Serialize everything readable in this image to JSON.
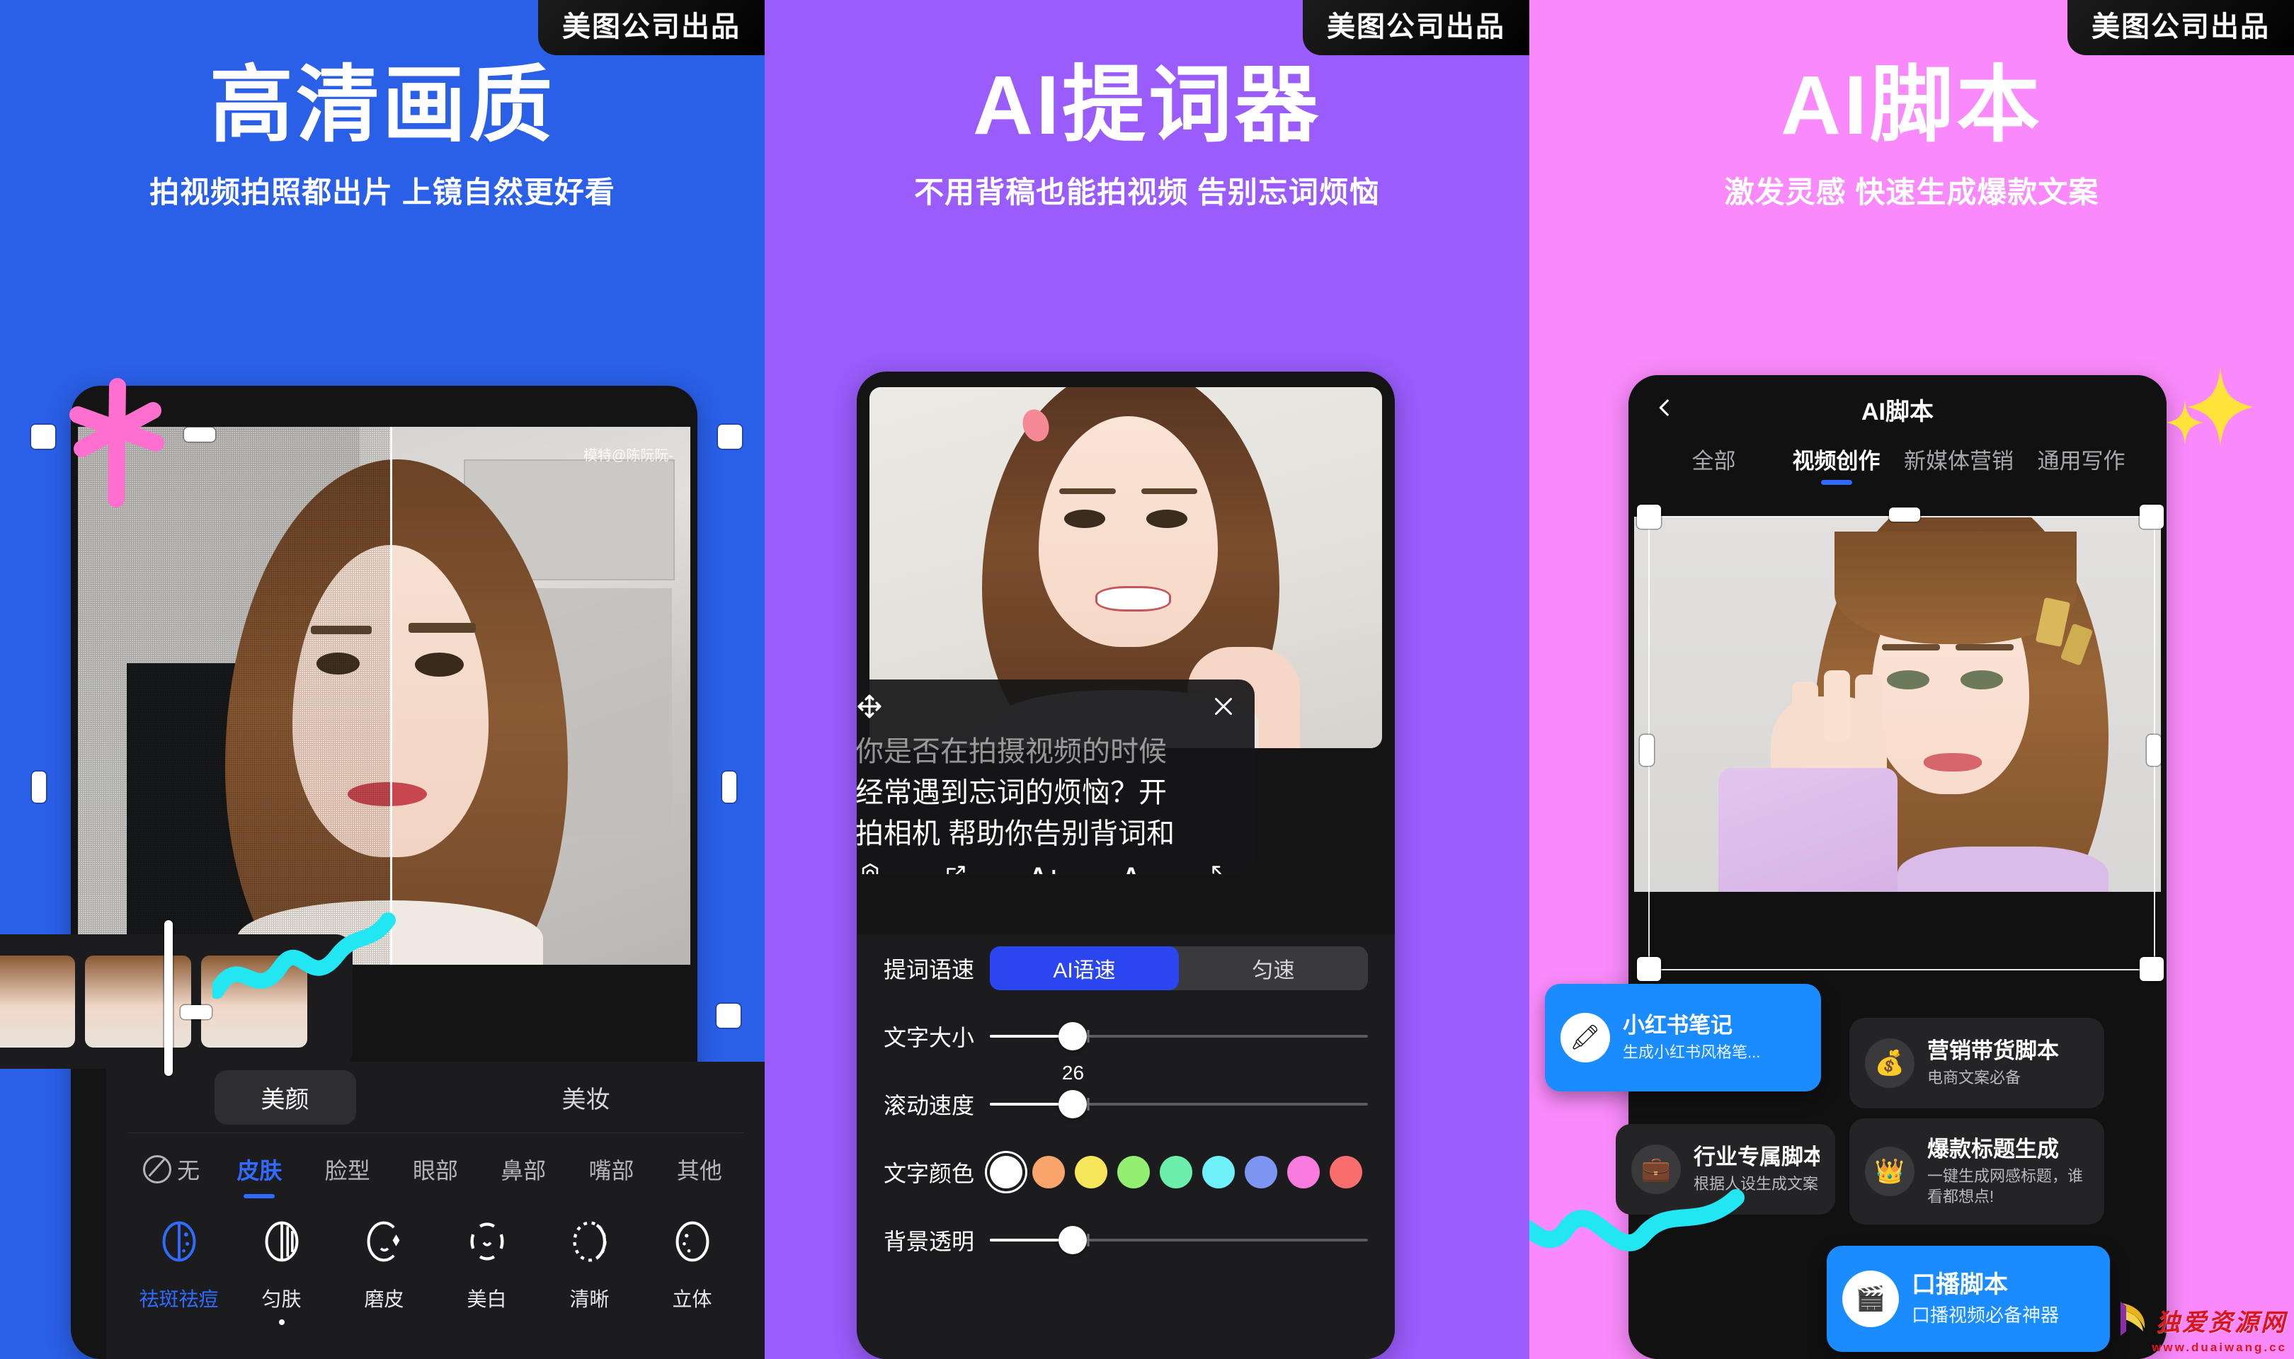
{
  "badge_label": "美图公司出品",
  "panels": [
    {
      "key": "hd",
      "bg": "#2A5FE8",
      "headline": "高清画质",
      "subhead": "拍视频拍照都出片 上镜自然更好看",
      "photo_credit": "模特@陈阮阮-",
      "bottom": {
        "tabs": [
          {
            "label": "美颜",
            "selected": true
          },
          {
            "label": "美妆",
            "selected": false
          }
        ],
        "categories": [
          {
            "label": "无",
            "icon": "none-circle-icon",
            "active": false
          },
          {
            "label": "皮肤",
            "active": true
          },
          {
            "label": "脸型",
            "active": false
          },
          {
            "label": "眼部",
            "active": false
          },
          {
            "label": "鼻部",
            "active": false
          },
          {
            "label": "嘴部",
            "active": false
          },
          {
            "label": "其他",
            "active": false
          }
        ],
        "tools": [
          {
            "label": "祛斑祛痘",
            "icon": "blemish-remove-icon",
            "active": true,
            "dot": false
          },
          {
            "label": "匀肤",
            "icon": "even-skin-icon",
            "active": false,
            "dot": true
          },
          {
            "label": "磨皮",
            "icon": "smooth-skin-icon",
            "active": false,
            "dot": false
          },
          {
            "label": "美白",
            "icon": "whiten-icon",
            "active": false,
            "dot": false
          },
          {
            "label": "清晰",
            "icon": "sharpen-icon",
            "active": false,
            "dot": false
          },
          {
            "label": "立体",
            "icon": "contour-icon",
            "active": false,
            "dot": false
          }
        ]
      }
    },
    {
      "key": "teleprompter",
      "bg": "#9A5CFC",
      "headline": "AI提词器",
      "subhead": "不用背稿也能拍视频 告别忘词烦恼",
      "teleprompter": {
        "move_icon": "move-arrows-icon",
        "close_icon": "close-icon",
        "lines": [
          {
            "text": "你是否在拍摄视频的时候",
            "dim": true
          },
          {
            "text": "经常遇到忘词的烦恼？开",
            "dim": false
          },
          {
            "text": "拍相机 帮助你告别背词和",
            "dim": false
          }
        ],
        "footer_icons": [
          {
            "name": "camera-icon",
            "glyph": "◎"
          },
          {
            "name": "edit-icon",
            "glyph": "✎"
          },
          {
            "name": "font-increase-icon",
            "glyph": "A+"
          },
          {
            "name": "font-decrease-icon",
            "glyph": "A-"
          },
          {
            "name": "resize-icon",
            "glyph": "⤢"
          }
        ]
      },
      "settings": {
        "speed_label": "提词语速",
        "speed_options": [
          {
            "label": "AI语速",
            "selected": true
          },
          {
            "label": "匀速",
            "selected": false
          }
        ],
        "text_size_label": "文字大小",
        "text_size_value": 22,
        "scroll_speed_label": "滚动速度",
        "scroll_speed_value": 26,
        "text_color_label": "文字颜色",
        "colors": [
          {
            "hex": "#FFFFFF",
            "selected": true
          },
          {
            "hex": "#F9A46A",
            "selected": false
          },
          {
            "hex": "#F7E55A",
            "selected": false
          },
          {
            "hex": "#93EE72",
            "selected": false
          },
          {
            "hex": "#6BEFAA",
            "selected": false
          },
          {
            "hex": "#6DF0F7",
            "selected": false
          },
          {
            "hex": "#7D96F2",
            "selected": false
          },
          {
            "hex": "#F97BE0",
            "selected": false
          },
          {
            "hex": "#F96D6D",
            "selected": false
          }
        ],
        "bg_opacity_label": "背景透明",
        "bg_opacity_value": 22
      }
    },
    {
      "key": "ai-script",
      "bg": "#FA8AFC",
      "headline": "AI脚本",
      "subhead": "激发灵感 快速生成爆款文案",
      "header": {
        "back_icon": "back-chevron-icon",
        "title": "AI脚本",
        "tabs": [
          {
            "label": "全部",
            "active": false
          },
          {
            "label": "视频创作",
            "active": true
          },
          {
            "label": "新媒体营销",
            "active": false
          },
          {
            "label": "通用写作",
            "active": false
          }
        ]
      },
      "cards": [
        {
          "title": "小红书笔记",
          "desc": "生成小红书风格笔...",
          "icon": "marker-pen-icon",
          "glyph": "🖍",
          "highlight": true
        },
        {
          "title": "营销带货脚本",
          "desc": "电商文案必备",
          "icon": "money-bag-icon",
          "glyph": "💰",
          "highlight": false
        },
        {
          "title": "行业专属脚本",
          "desc": "根据人设生成文案",
          "icon": "briefcase-icon",
          "glyph": "💼",
          "highlight": false
        },
        {
          "title": "爆款标题生成",
          "desc": "一键生成网感标题，谁看都想点!",
          "icon": "crown-icon",
          "glyph": "👑",
          "highlight": false
        },
        {
          "title": "口播脚本",
          "desc": "口播视频必备神器",
          "icon": "clapperboard-icon",
          "glyph": "🎬",
          "highlight": true
        }
      ]
    }
  ],
  "watermark": {
    "title": "独爱资源网",
    "url": "www.duaiwang.cc"
  }
}
